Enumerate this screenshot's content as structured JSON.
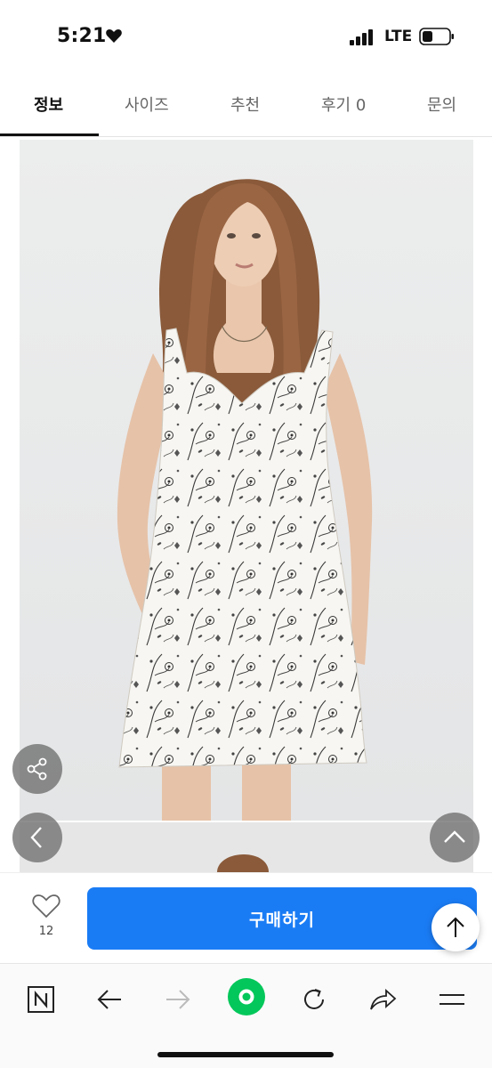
{
  "status_bar": {
    "time": "5:21",
    "network": "LTE"
  },
  "tabs": [
    {
      "label": "정보",
      "active": true
    },
    {
      "label": "사이즈",
      "active": false
    },
    {
      "label": "추천",
      "active": false
    },
    {
      "label": "후기 0",
      "active": false
    },
    {
      "label": "문의",
      "active": false
    }
  ],
  "purchase_bar": {
    "like_count": "12",
    "buy_label": "구매하기"
  },
  "colors": {
    "accent": "#1a7cf5",
    "active_tab": "#111111",
    "naver_green": "#03c75a"
  }
}
